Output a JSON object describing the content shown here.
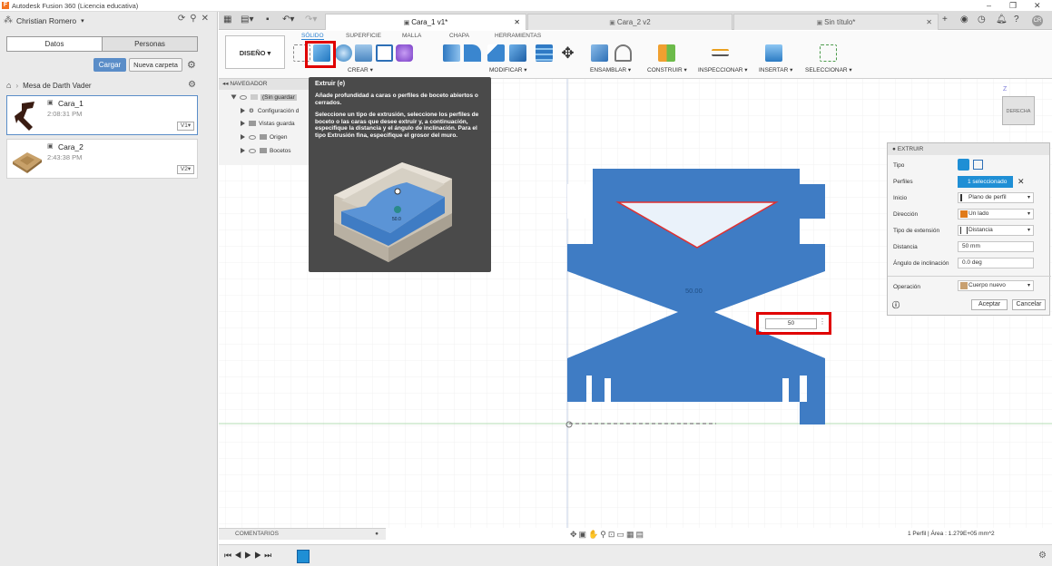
{
  "window": {
    "title": "Autodesk Fusion 360 (Licencia educativa)"
  },
  "left_panel": {
    "user_name": "Christian Romero",
    "tabs": [
      "Datos",
      "Personas"
    ],
    "upload_label": "Cargar",
    "new_folder_label": "Nueva carpeta",
    "project_name": "Mesa de Darth Vader",
    "files": [
      {
        "name": "Cara_1",
        "time": "2:08:31 PM",
        "version": "V1"
      },
      {
        "name": "Cara_2",
        "time": "2:43:38 PM",
        "version": "V2"
      }
    ]
  },
  "doc_tabs": [
    {
      "label": "Cara_1 v1*",
      "active": true
    },
    {
      "label": "Cara_2 v2",
      "active": false
    },
    {
      "label": "Sin título*",
      "active": false
    }
  ],
  "toolbar": {
    "workspace": "DISEÑO",
    "workspace_tabs": [
      "SÓLIDO",
      "SUPERFICIE",
      "MALLA",
      "CHAPA",
      "HERRAMIENTAS"
    ],
    "groups": [
      "CREAR",
      "MODIFICAR",
      "ENSAMBLAR",
      "CONSTRUIR",
      "INSPECCIONAR",
      "INSERTAR",
      "SELECCIONAR"
    ]
  },
  "navigator": {
    "header": "NAVEGADOR",
    "root": "(Sin guardar",
    "items": [
      "Configuración d",
      "Vistas guarda",
      "Origen",
      "Bocetos"
    ]
  },
  "tooltip": {
    "title": "Extruir (e)",
    "p1": "Añade profundidad a caras o perfiles de boceto abiertos o cerrados.",
    "p2": "Seleccione un tipo de extrusión, seleccione los perfiles de boceto o las caras que desee extruir y, a continuación, especifique la distancia y el ángulo de inclinación. Para el tipo Extrusión fina, especifique el grosor del muro.",
    "image_label": "50.0"
  },
  "extrude_panel": {
    "title": "EXTRUIR",
    "rows": [
      {
        "label": "Tipo",
        "value": ""
      },
      {
        "label": "Perfiles",
        "value": "1 seleccionado"
      },
      {
        "label": "Inicio",
        "value": "Plano de perfil"
      },
      {
        "label": "Dirección",
        "value": "Un lado"
      },
      {
        "label": "Tipo de extensión",
        "value": "Distancia"
      },
      {
        "label": "Distancia",
        "value": "50 mm"
      },
      {
        "label": "Ángulo de inclinación",
        "value": "0.0 deg"
      },
      {
        "label": "Operación",
        "value": "Cuerpo nuevo"
      }
    ],
    "ok_label": "Aceptar",
    "cancel_label": "Cancelar"
  },
  "canvas": {
    "dimension_label": "50.00",
    "distance_input": "50",
    "viewcube_label": "DERECHA",
    "shape_color": "#3f7cc4"
  },
  "bottom": {
    "comments_label": "COMENTARIOS",
    "status_text": "1 Perfil | Área : 1.279E+05 mm^2"
  }
}
